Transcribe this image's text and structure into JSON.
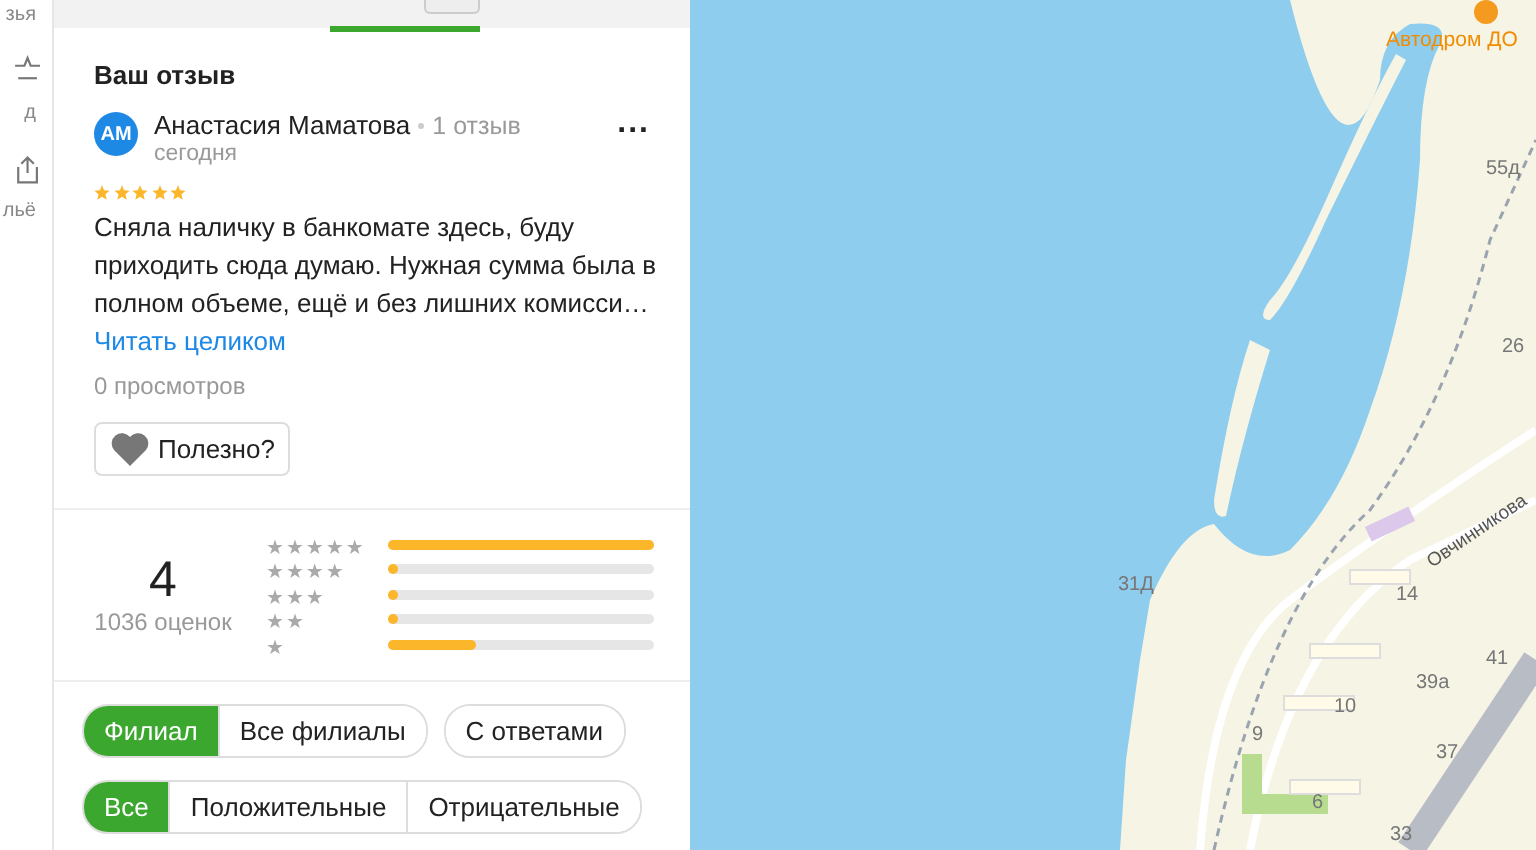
{
  "rail": {
    "items": [
      {
        "label": "зья",
        "kind": "text"
      },
      {
        "label": "д",
        "kind": "star"
      },
      {
        "label": "льё",
        "kind": "share"
      }
    ]
  },
  "review": {
    "heading": "Ваш отзыв",
    "avatar": "АМ",
    "author": "Анастасия Маматова",
    "count": "1 отзыв",
    "date": "сегодня",
    "more": "...",
    "stars": 5,
    "text": "Сняла наличку в банкомате здесь, буду приходить сюда думаю. Нужная сумма была в полном объеме, ещё и без лишних комисси…",
    "read_more": "Читать целиком",
    "views": "0 просмотров",
    "useful": "Полезно?"
  },
  "summary": {
    "score": "4",
    "count": "1036 оценок",
    "bars": [
      {
        "label": "★★★★★",
        "level": 1.0
      },
      {
        "label": "★★★★",
        "level": 0.03
      },
      {
        "label": "★★★",
        "level": 0.03
      },
      {
        "label": "★★",
        "level": 0.03
      },
      {
        "label": "★",
        "level": 0.33
      }
    ]
  },
  "filters": [
    [
      {
        "label": "Филиал",
        "selected": true
      },
      {
        "label": "Все филиалы",
        "selected": false
      }
    ],
    [
      {
        "label": "С ответами",
        "selected": false
      }
    ]
  ],
  "filters2": [
    [
      {
        "label": "Все",
        "selected": true
      },
      {
        "label": "Положительные",
        "selected": false
      },
      {
        "label": "Отрицательные",
        "selected": false
      }
    ]
  ],
  "map": {
    "poi": "Автодром ДО",
    "street": "Овчинникова",
    "labels": [
      "55д",
      "26",
      "31Д",
      "14",
      "41",
      "39а",
      "10",
      "9",
      "37",
      "6",
      "33"
    ]
  }
}
